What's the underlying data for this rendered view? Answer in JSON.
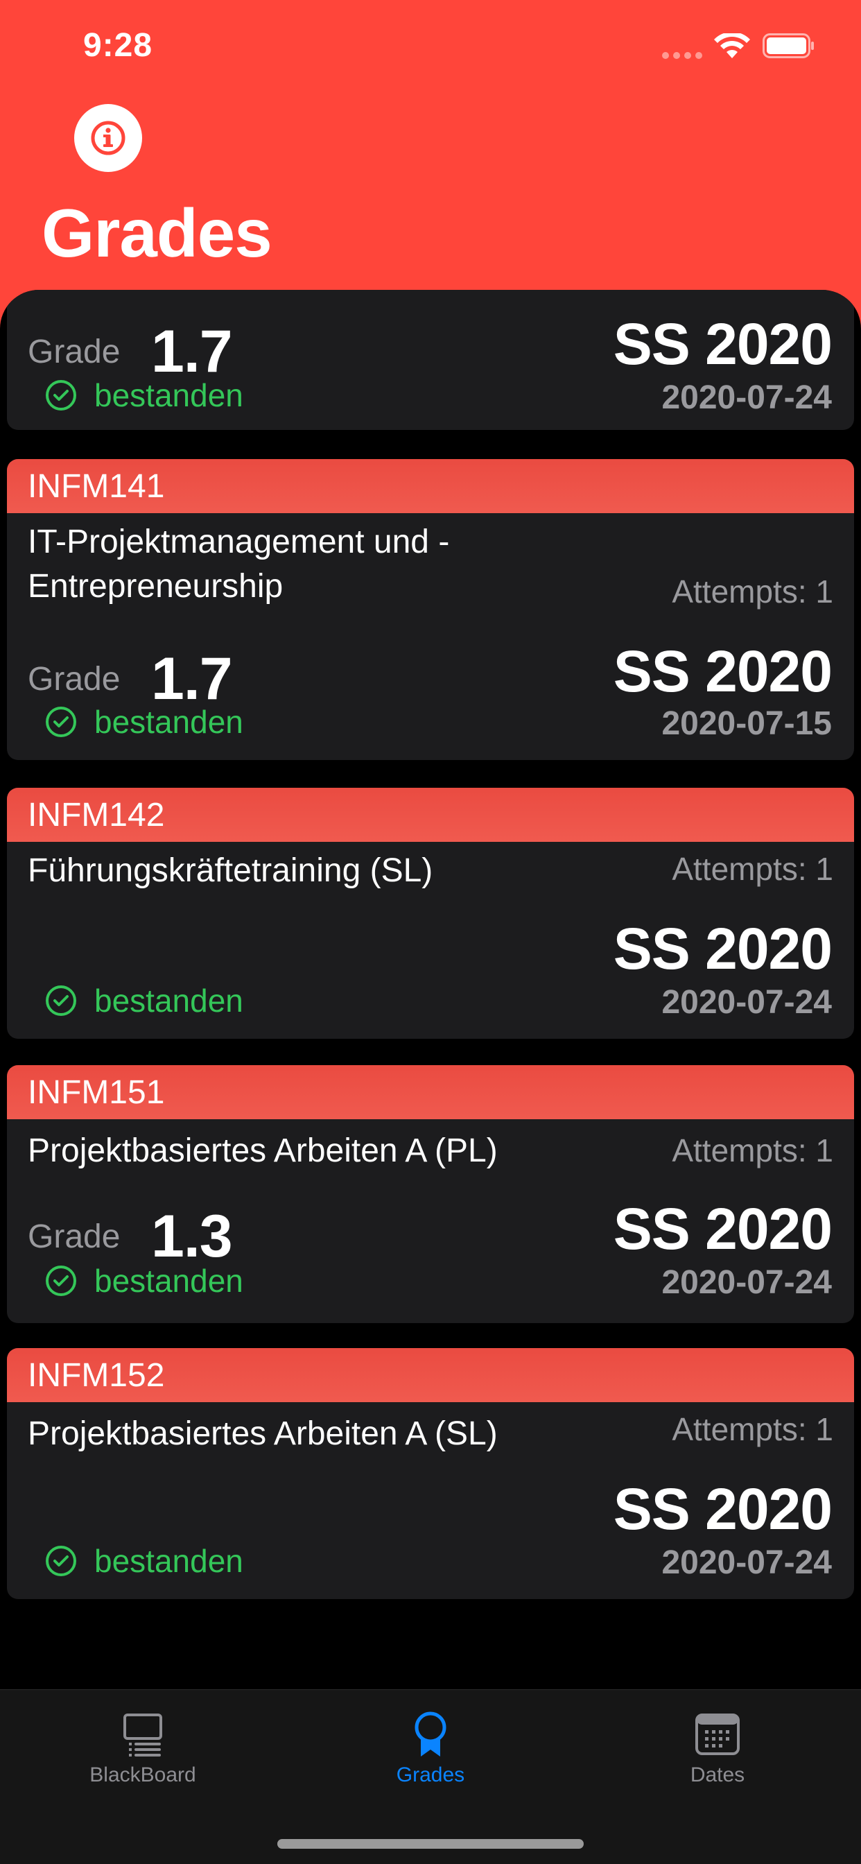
{
  "status_bar": {
    "time": "9:28"
  },
  "header": {
    "title": "Grades",
    "info_icon": "info-circle-icon"
  },
  "grades": [
    {
      "code": "",
      "title": "",
      "attempts": "",
      "grade_label": "Grade",
      "grade": "1.7",
      "semester": "SS 2020",
      "status": "bestanden",
      "date": "2020-07-24"
    },
    {
      "code": "INFM141",
      "title": "IT-Projektmanagement und -Entrepreneurship",
      "attempts": "Attempts: 1",
      "grade_label": "Grade",
      "grade": "1.7",
      "semester": "SS 2020",
      "status": "bestanden",
      "date": "2020-07-15"
    },
    {
      "code": "INFM142",
      "title": "Führungskräftetraining (SL)",
      "attempts": "Attempts: 1",
      "grade_label": "",
      "grade": "",
      "semester": "SS 2020",
      "status": "bestanden",
      "date": "2020-07-24"
    },
    {
      "code": "INFM151",
      "title": "Projektbasiertes Arbeiten A (PL)",
      "attempts": "Attempts: 1",
      "grade_label": "Grade",
      "grade": "1.3",
      "semester": "SS 2020",
      "status": "bestanden",
      "date": "2020-07-24"
    },
    {
      "code": "INFM152",
      "title": "Projektbasiertes Arbeiten A (SL)",
      "attempts": "Attempts: 1",
      "grade_label": "",
      "grade": "",
      "semester": "SS 2020",
      "status": "bestanden",
      "date": "2020-07-24"
    }
  ],
  "tab_bar": {
    "tabs": [
      {
        "label": "BlackBoard",
        "icon": "blackboard-icon",
        "active": false
      },
      {
        "label": "Grades",
        "icon": "award-ribbon-icon",
        "active": true
      },
      {
        "label": "Dates",
        "icon": "calendar-icon",
        "active": false
      }
    ]
  },
  "colors": {
    "accent_red": "#ff453a",
    "passed_green": "#34c759",
    "active_tab_blue": "#0a84ff"
  }
}
